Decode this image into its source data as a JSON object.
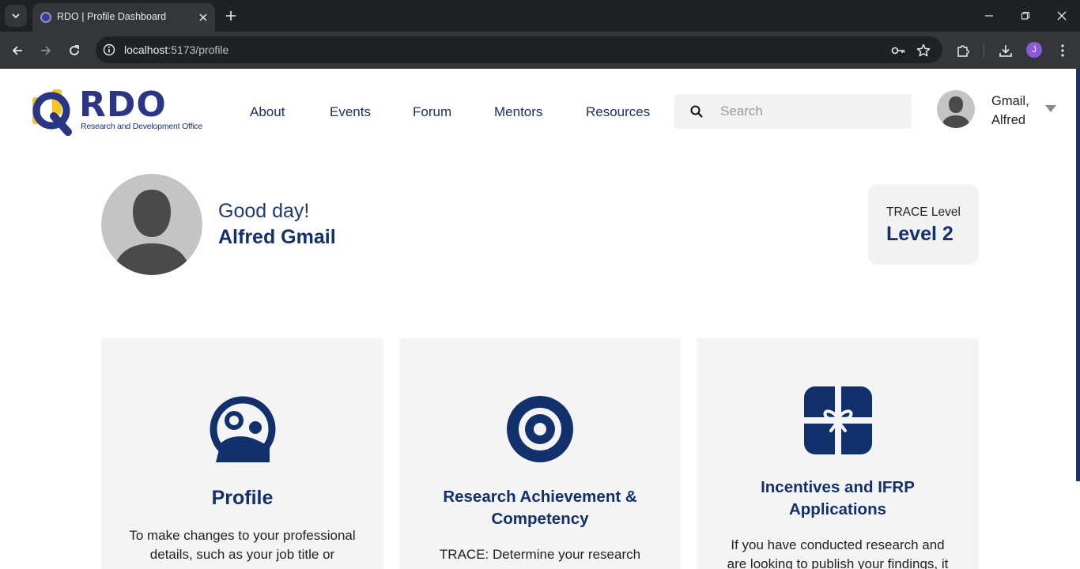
{
  "browser": {
    "tab_title": "RDO | Profile Dashboard",
    "url_host": "localhost",
    "url_rest": ":5173/profile",
    "profile_initial": "J"
  },
  "header": {
    "logo_word": "RDO",
    "logo_subtitle": "Research and Development Office",
    "nav": [
      "About",
      "Events",
      "Forum",
      "Mentors",
      "Resources"
    ],
    "search_placeholder": "Search",
    "user_last": "Gmail,",
    "user_first": "Alfred"
  },
  "hero": {
    "greeting": "Good day!",
    "name": "Alfred Gmail",
    "trace_label": "TRACE Level",
    "trace_value": "Level 2"
  },
  "cards": [
    {
      "icon": "profile-icon",
      "title": "Profile",
      "desc_line1": "To make changes to your professional",
      "desc_line2": "details, such as your job title or"
    },
    {
      "icon": "target-icon",
      "title_line1": "Research Achievement &",
      "title_line2": "Competency",
      "desc_line1": "TRACE: Determine your research"
    },
    {
      "icon": "gift-icon",
      "title_line1": "Incentives and IFRP",
      "title_line2": "Applications",
      "desc_line1": "If you have conducted research and",
      "desc_line2": "are looking to publish your findings, it"
    }
  ],
  "colors": {
    "navy": "#12306b",
    "chrome_dark": "#202124",
    "card_bg": "#f4f4f4"
  }
}
